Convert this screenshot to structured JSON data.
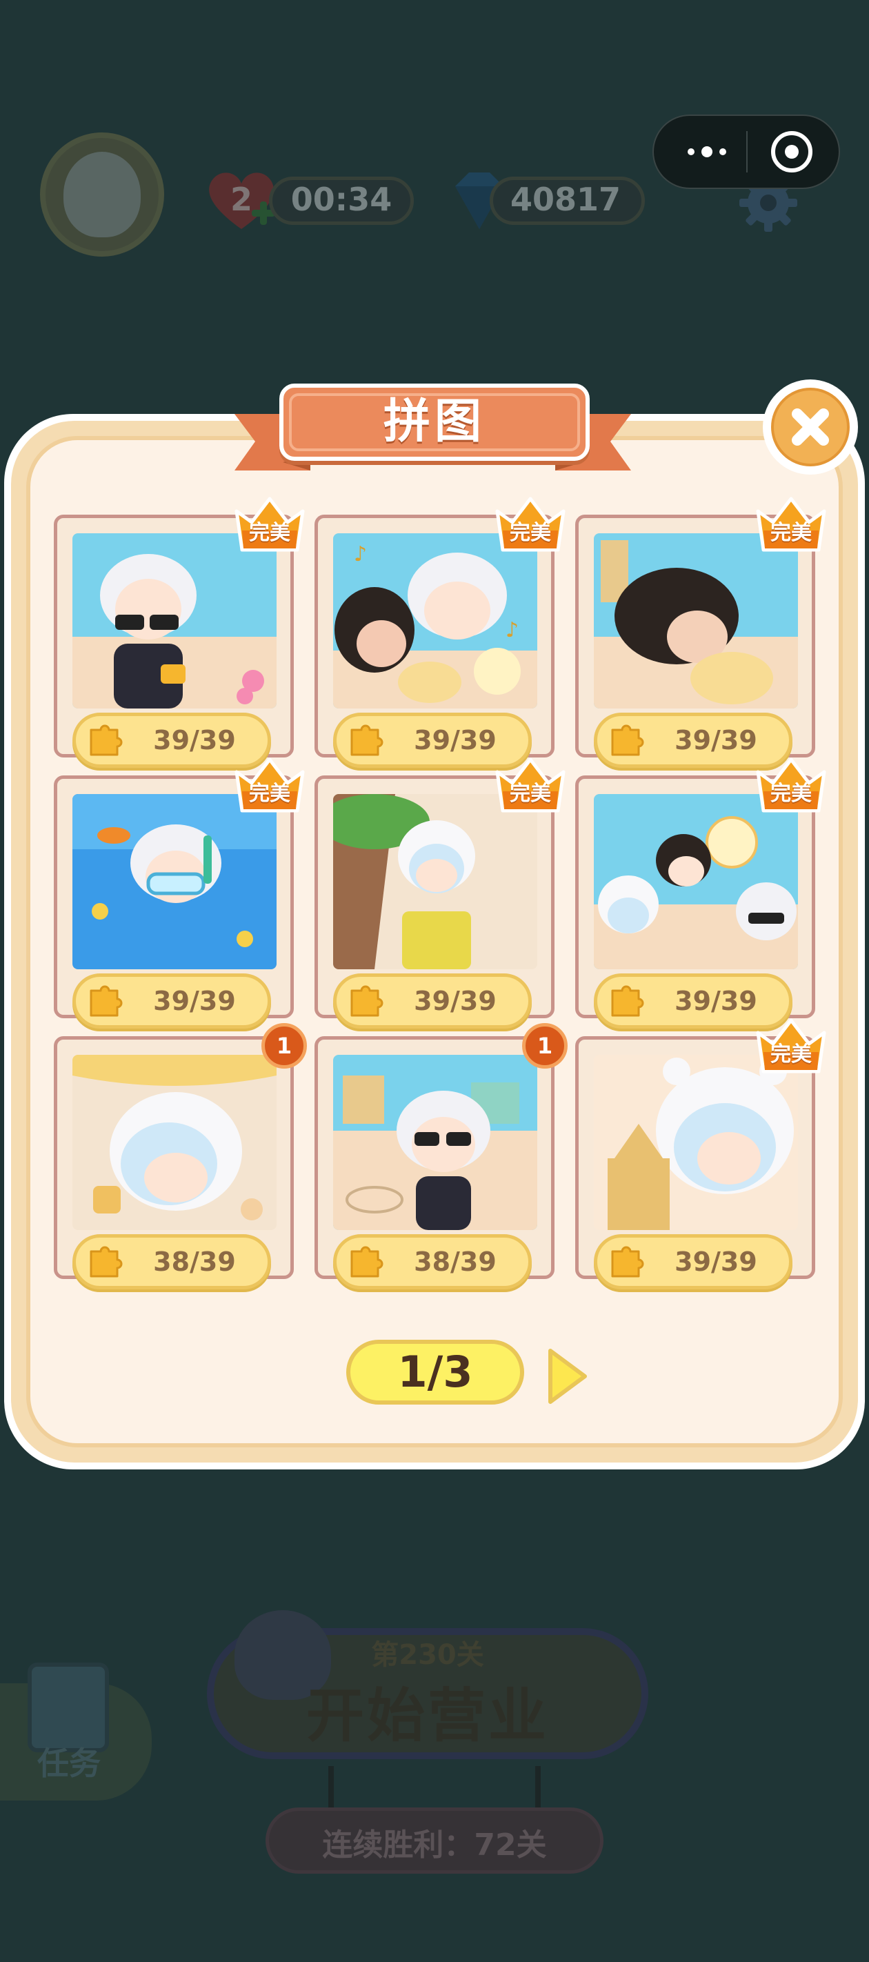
{
  "hud": {
    "lives": "2",
    "timer": "00:34",
    "gems": "40817"
  },
  "capsule": {
    "more_icon": "more-dots-icon",
    "close_icon": "target-circle-icon"
  },
  "modal": {
    "title": "拼图",
    "close_icon": "close-x-icon"
  },
  "puzzles": [
    {
      "progress": "39/39",
      "crown": "完美",
      "scene": "beach-camera"
    },
    {
      "progress": "39/39",
      "crown": "完美",
      "scene": "beach-music"
    },
    {
      "progress": "39/39",
      "crown": "完美",
      "scene": "sandcastle-nap"
    },
    {
      "progress": "39/39",
      "crown": "完美",
      "scene": "snorkel-underwater"
    },
    {
      "progress": "39/39",
      "crown": "完美",
      "scene": "palm-suitcase"
    },
    {
      "progress": "39/39",
      "crown": "完美",
      "scene": "beach-ball-trio"
    },
    {
      "progress": "38/39",
      "badge": "1",
      "scene": "umbrella-bear"
    },
    {
      "progress": "38/39",
      "badge": "1",
      "scene": "sand-drawing"
    },
    {
      "progress": "39/39",
      "crown": "完美",
      "scene": "bear-sandcastle"
    }
  ],
  "pager": {
    "label": "1/3",
    "next_icon": "triangle-right-icon"
  },
  "bottom": {
    "task_label": "任务",
    "level_label": "第230关",
    "start_label": "开始营业",
    "streak_label": "连续胜利：72关"
  },
  "colors": {
    "overlay_bg": "#1f3536",
    "modal_fill": "#fdf2e6",
    "banner": "#eb8a5c",
    "close_btn": "#f2b154",
    "progress_pill": "#fde38f",
    "pager": "#fdf164",
    "badge": "#d9591a"
  }
}
